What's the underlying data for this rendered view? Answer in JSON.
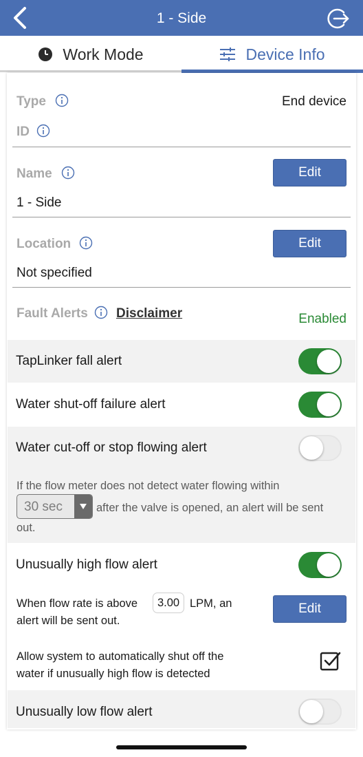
{
  "header": {
    "title": "1 - Side",
    "background": "#4a6fb3"
  },
  "tabs": [
    {
      "label": "Work Mode",
      "icon": "clock-icon",
      "active": false
    },
    {
      "label": "Device Info",
      "icon": "sliders-icon",
      "active": true
    }
  ],
  "device": {
    "type_label": "Type",
    "type_value": "End device",
    "id_label": "ID",
    "id_value": "",
    "name_label": "Name",
    "name_value": "1 - Side",
    "location_label": "Location",
    "location_value": "Not specified",
    "edit_label": "Edit"
  },
  "fault_alerts": {
    "label": "Fault Alerts",
    "disclaimer": "Disclaimer",
    "status": "Enabled",
    "status_color": "#2a8a35"
  },
  "alerts": [
    {
      "label": "TapLinker fall alert",
      "enabled": true
    },
    {
      "label": "Water shut-off failure alert",
      "enabled": true
    },
    {
      "label": "Water cut-off or stop flowing alert",
      "enabled": false
    },
    {
      "label": "Unusually high flow alert",
      "enabled": true
    },
    {
      "label": "Unusually low flow alert",
      "enabled": false
    }
  ],
  "stop_flow_text": {
    "line1": "If the flow meter does not detect water flowing within",
    "select_value": "30 sec",
    "after_select": "after the valve is opened, an alert will be sent",
    "line3": "out."
  },
  "high_flow_text": {
    "before": "When flow rate is above",
    "value": "3.00",
    "after": "LPM, an",
    "line2": "alert will be sent out.",
    "edit_label": "Edit"
  },
  "auto_shutoff": {
    "line1": "Allow system to automatically shut off the",
    "line2": "water if unusually high flow is detected",
    "checked": true
  }
}
